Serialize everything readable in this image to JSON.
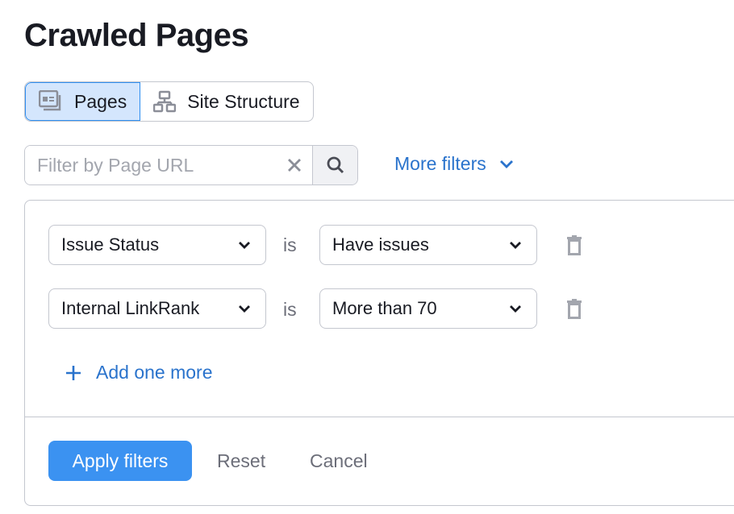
{
  "title": "Crawled Pages",
  "tabs": [
    {
      "label": "Pages",
      "icon": "pages-icon",
      "active": true
    },
    {
      "label": "Site Structure",
      "icon": "site-structure-icon",
      "active": false
    }
  ],
  "search": {
    "placeholder": "Filter by Page URL",
    "value": ""
  },
  "more_filters": "More filters",
  "filters": [
    {
      "field": "Issue Status",
      "operator": "is",
      "value": "Have issues"
    },
    {
      "field": "Internal LinkRank",
      "operator": "is",
      "value": "More than 70"
    }
  ],
  "add_more": "Add one more",
  "actions": {
    "apply": "Apply filters",
    "reset": "Reset",
    "cancel": "Cancel"
  },
  "colors": {
    "accent": "#3b92f1",
    "link": "#2a73cc",
    "active_tab": "#d4e6fd"
  }
}
